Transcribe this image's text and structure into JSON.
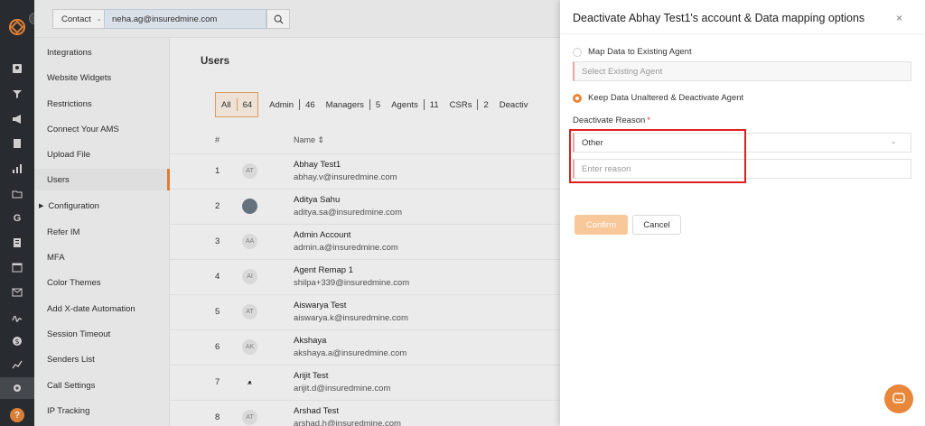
{
  "rail": {
    "icons": [
      "contacts-icon",
      "funnel-icon",
      "megaphone-icon",
      "document-icon",
      "bar-chart-icon",
      "folder-icon",
      "google-icon",
      "list-icon",
      "calendar-icon",
      "mail-icon",
      "signature-icon",
      "dollar-icon",
      "trend-icon",
      "settings-icon"
    ],
    "help_label": "?"
  },
  "submenu": {
    "toggle": "›",
    "items": [
      "Integrations",
      "Website Widgets",
      "Restrictions",
      "Connect Your AMS",
      "Upload File",
      "Users",
      "Configuration",
      "Refer IM",
      "MFA",
      "Color Themes",
      "Add X-date Automation",
      "Session Timeout",
      "Senders List",
      "Call Settings",
      "IP Tracking"
    ],
    "selected": "Users"
  },
  "topbar": {
    "context_label": "Contact",
    "search_value": "neha.ag@insuredmine.com"
  },
  "main": {
    "title": "Users",
    "filters": {
      "all_label": "All",
      "all_count": "64",
      "admin_label": "Admin",
      "admin_count": "46",
      "managers_label": "Managers",
      "managers_count": "5",
      "agents_label": "Agents",
      "agents_count": "11",
      "csrs_label": "CSRs",
      "csrs_count": "2",
      "deactivated_label": "Deactiv"
    },
    "columns": {
      "number": "#",
      "name": "Name ⇕"
    },
    "rows": [
      {
        "num": "1",
        "initials": "AT",
        "name": "Abhay Test1",
        "email": "abhay.v@insuredmine.com"
      },
      {
        "num": "2",
        "initials": "",
        "name": "Aditya Sahu",
        "email": "aditya.sa@insuredmine.com"
      },
      {
        "num": "3",
        "initials": "AA",
        "name": "Admin Account",
        "email": "admin.a@insuredmine.com"
      },
      {
        "num": "4",
        "initials": "AI",
        "name": "Agent Remap 1",
        "email": "shilpa+339@insuredmine.com"
      },
      {
        "num": "5",
        "initials": "AT",
        "name": "Aiswarya Test",
        "email": "aiswarya.k@insuredmine.com"
      },
      {
        "num": "6",
        "initials": "AK",
        "name": "Akshaya",
        "email": "akshaya.a@insuredmine.com"
      },
      {
        "num": "7",
        "initials": "",
        "name": "Arijit Test",
        "email": "arijit.d@insuredmine.com"
      },
      {
        "num": "8",
        "initials": "AT",
        "name": "Arshad Test",
        "email": "arshad.h@insuredmine.com"
      }
    ]
  },
  "drawer": {
    "title": "Deactivate Abhay Test1's account & Data mapping options",
    "close": "×",
    "option_map": "Map Data to Existing Agent",
    "select_agent_placeholder": "Select Existing Agent",
    "option_keep": "Keep Data Unaltered & Deactivate Agent",
    "reason_label": "Deactivate Reason",
    "required_mark": "*",
    "reason_select_value": "Other",
    "reason_placeholder": "Enter reason",
    "confirm_label": "Confirm",
    "cancel_label": "Cancel"
  },
  "colors": {
    "accent": "#e8863a",
    "highlight_box": "#e02020",
    "rail_bg": "#2b2e33"
  }
}
